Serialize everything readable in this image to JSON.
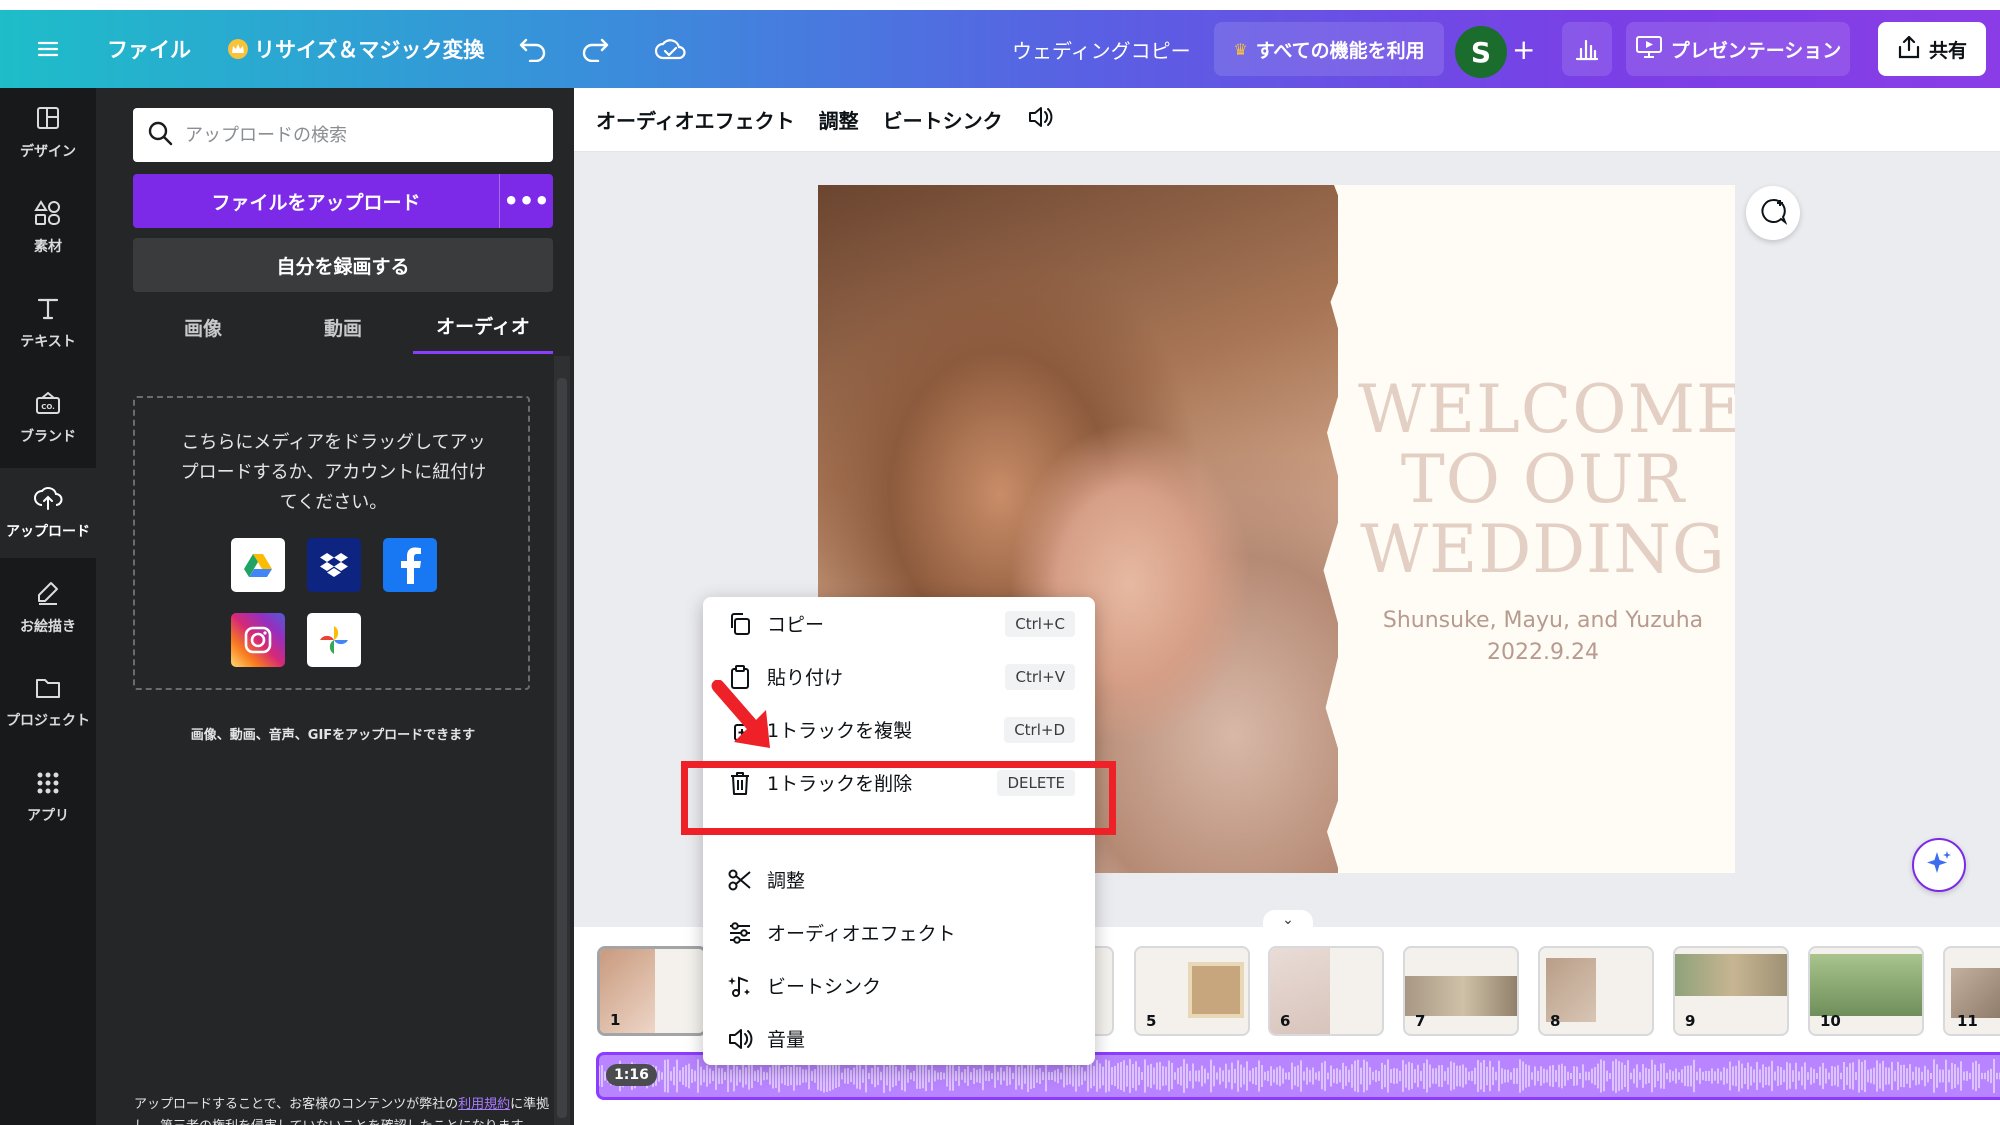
{
  "topbar": {
    "menu_icon": "hamburger-icon",
    "file": "ファイル",
    "resize": "リサイズ＆マジック変換",
    "title": "ウェディングコピー",
    "pro": "すべての機能を利用",
    "avatar_letter": "S",
    "present": "プレゼンテーション",
    "share": "共有"
  },
  "rail": [
    {
      "label": "デザイン",
      "icon": "layout-icon"
    },
    {
      "label": "素材",
      "icon": "shapes-icon"
    },
    {
      "label": "テキスト",
      "icon": "text-icon"
    },
    {
      "label": "ブランド",
      "icon": "brand-icon"
    },
    {
      "label": "アップロード",
      "icon": "cloud-upload-icon"
    },
    {
      "label": "お絵描き",
      "icon": "pen-icon"
    },
    {
      "label": "プロジェクト",
      "icon": "folder-icon"
    },
    {
      "label": "アプリ",
      "icon": "apps-icon"
    }
  ],
  "panel": {
    "search_placeholder": "アップロードの検索",
    "upload_button": "ファイルをアップロード",
    "more": "•••",
    "record_button": "自分を録画する",
    "tabs": [
      "画像",
      "動画",
      "オーディオ"
    ],
    "dropzone_text": "こちらにメディアをドラッグしてアップロードするか、アカウントに紐付けてください。",
    "note": "画像、動画、音声、GIFをアップロードできます",
    "footer_before": "アップロードすることで、お客様のコンテンツが弊社の",
    "footer_link": "利用規約",
    "footer_after": "に準拠し、第三者の権利を侵害していないことを確認したことになります。"
  },
  "editor_bar": {
    "audio_effects": "オーディオエフェクト",
    "adjust": "調整",
    "beat_sync": "ビートシンク"
  },
  "design": {
    "welcome": "WELCOME TO OUR WEDDING",
    "names": "Shunsuke, Mayu, and Yuzuha",
    "date": "2022.9.24"
  },
  "context_menu": [
    {
      "label": "コピー",
      "shortcut": "Ctrl+C",
      "icon": "copy-icon"
    },
    {
      "label": "貼り付け",
      "shortcut": "Ctrl+V",
      "icon": "clipboard-icon"
    },
    {
      "label": "1トラックを複製",
      "shortcut": "Ctrl+D",
      "icon": "duplicate-icon"
    },
    {
      "label": "1トラックを削除",
      "shortcut": "DELETE",
      "icon": "trash-icon"
    },
    {
      "label": "調整",
      "shortcut": "",
      "icon": "scissors-icon"
    },
    {
      "label": "オーディオエフェクト",
      "shortcut": "",
      "icon": "sliders-icon"
    },
    {
      "label": "ビートシンク",
      "shortcut": "",
      "icon": "beat-icon"
    },
    {
      "label": "音量",
      "shortcut": "",
      "icon": "volume-icon"
    }
  ],
  "timeline": {
    "pages": [
      "1",
      "5",
      "6",
      "7",
      "8",
      "9",
      "10",
      "11"
    ],
    "audio_duration": "1:16"
  },
  "colors": {
    "accent": "#8b3dff",
    "highlight": "#ee2028"
  }
}
